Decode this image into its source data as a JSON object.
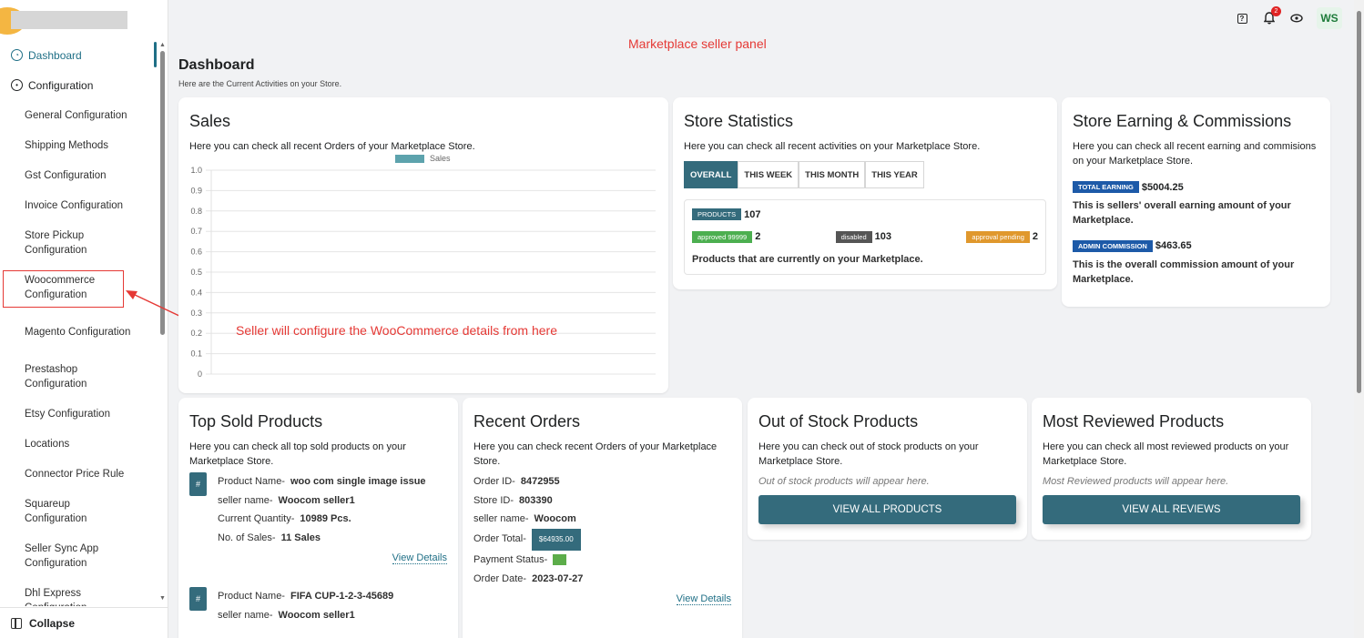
{
  "annotations": {
    "top": "Marketplace seller panel",
    "mid": "Seller will configure the WooCommerce details from here"
  },
  "sidebar": {
    "dashboard": "Dashboard",
    "configuration": "Configuration",
    "items": [
      "General Configuration",
      "Shipping Methods",
      "Gst Configuration",
      "Invoice Configuration",
      "Store Pickup Configuration",
      "Woocommerce Configuration",
      "Magento Configuration",
      "Prestashop Configuration",
      "Etsy Configuration",
      "Locations",
      "Connector Price Rule",
      "Squareup Configuration",
      "Seller Sync App Configuration",
      "Dhl Express Configuration"
    ],
    "collapse": "Collapse"
  },
  "topbar": {
    "notification_count": "2",
    "avatar_initials": "WS"
  },
  "page": {
    "title": "Dashboard",
    "subtitle": "Here are the Current Activities on your Store."
  },
  "sales": {
    "title": "Sales",
    "desc": "Here you can check all recent Orders of your Marketplace Store."
  },
  "chart_data": {
    "type": "bar",
    "legend": [
      "Sales"
    ],
    "series": [
      {
        "name": "Sales",
        "values": []
      }
    ],
    "yticks": [
      "1.0",
      "0.9",
      "0.8",
      "0.7",
      "0.6",
      "0.5",
      "0.4",
      "0.3",
      "0.2",
      "0.1",
      "0"
    ],
    "ylim": [
      0,
      1
    ],
    "grid": true,
    "legend_position": "top-center",
    "color": "#5da3ad"
  },
  "stats": {
    "title": "Store Statistics",
    "desc": "Here you can check all recent activities on your Marketplace Store.",
    "tabs": [
      "OVERALL",
      "THIS WEEK",
      "THIS MONTH",
      "THIS YEAR"
    ],
    "products_label": "PRODUCTS",
    "products_count": "107",
    "approved_label": "approved 99999",
    "approved_count": "2",
    "disabled_label": "disabled",
    "disabled_count": "103",
    "pending_label": "approval pending",
    "pending_count": "2",
    "footer": "Products that are currently on your Marketplace."
  },
  "earnings": {
    "title": "Store Earning & Commissions",
    "desc": "Here you can check all recent earning and commisions on your Marketplace Store.",
    "total_label": "TOTAL EARNING",
    "total_value": "$5004.25",
    "total_desc": "This is sellers' overall earning amount of your Marketplace.",
    "admin_label": "ADMIN COMMISSION",
    "admin_value": "$463.65",
    "admin_desc": "This is the overall commission amount of your Marketplace."
  },
  "top_sold": {
    "title": "Top Sold Products",
    "desc": "Here you can check all top sold products on your Marketplace Store.",
    "hash": "#",
    "labels": {
      "product_name": "Product Name-",
      "seller_name": "seller name-",
      "quantity": "Current Quantity-",
      "sales": "No. of Sales-"
    },
    "items": [
      {
        "product_name": "woo com single image issue",
        "seller_name": "Woocom seller1",
        "quantity": "10989 Pcs.",
        "sales": "11 Sales"
      },
      {
        "product_name": "FIFA CUP-1-2-3-45689",
        "seller_name": "Woocom seller1"
      }
    ],
    "view_details": "View Details"
  },
  "recent_orders": {
    "title": "Recent Orders",
    "desc": "Here you can check recent Orders of your Marketplace Store.",
    "labels": {
      "order_id": "Order ID-",
      "store_id": "Store ID-",
      "seller_name": "seller name-",
      "order_total": "Order Total-",
      "payment_status": "Payment Status-",
      "order_date": "Order Date-"
    },
    "order": {
      "order_id": "8472955",
      "store_id": "803390",
      "seller_name": "Woocom",
      "order_total": "$64935.00",
      "order_date": "2023-07-27"
    },
    "view_details": "View Details"
  },
  "out_of_stock": {
    "title": "Out of Stock Products",
    "desc": "Here you can check out of stock products on your Marketplace Store.",
    "empty": "Out of stock products will appear here.",
    "button": "VIEW ALL PRODUCTS"
  },
  "most_reviewed": {
    "title": "Most Reviewed Products",
    "desc": "Here you can check all most reviewed products on your Marketplace Store.",
    "empty": "Most Reviewed products will appear here.",
    "button": "VIEW ALL REVIEWS"
  }
}
